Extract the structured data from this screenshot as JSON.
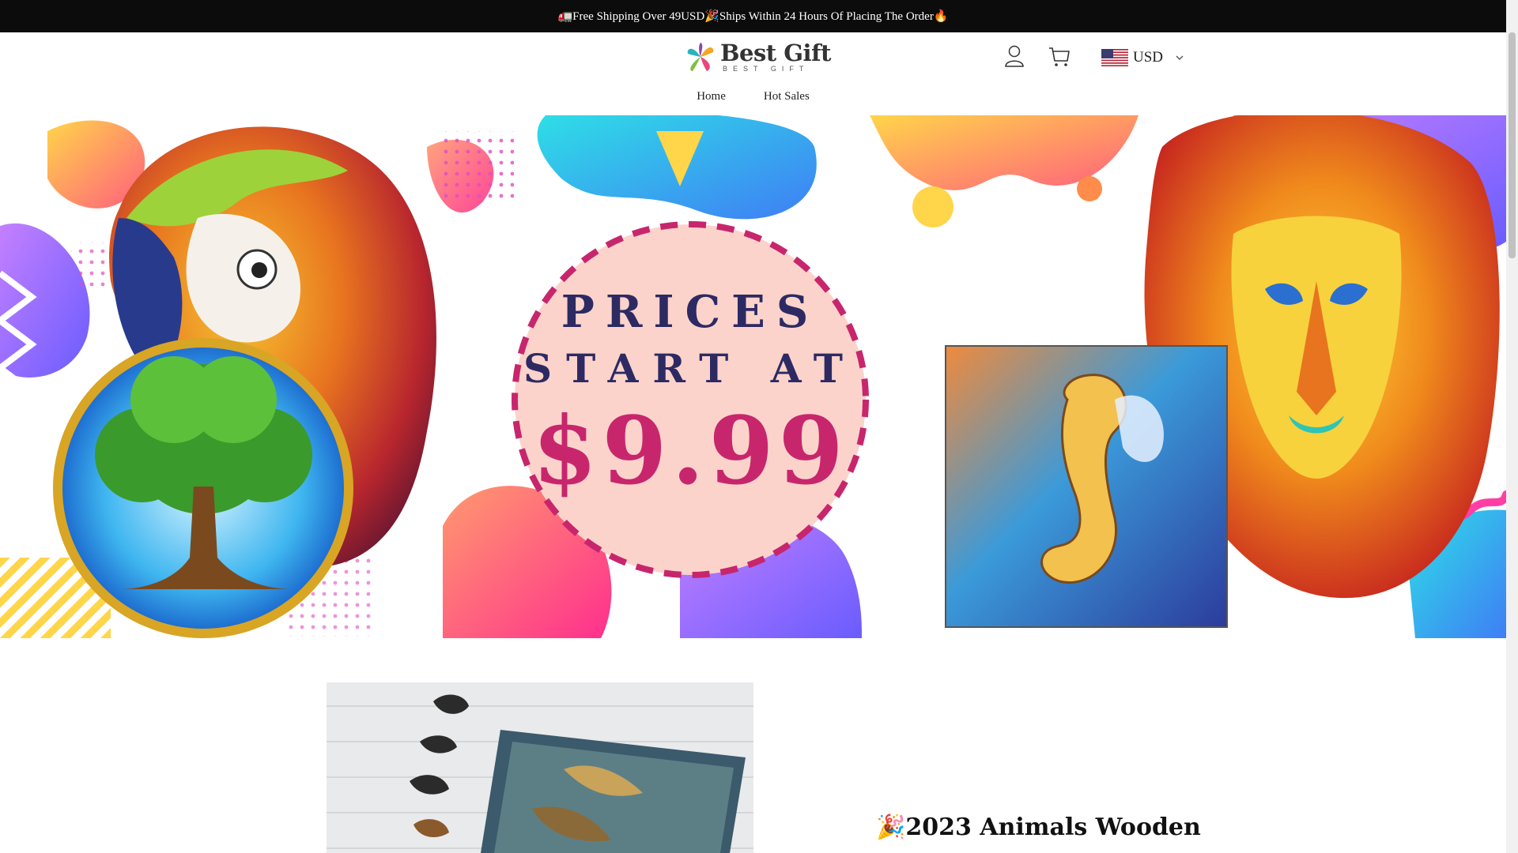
{
  "announcement": {
    "text": "🚛Free Shipping Over 49USD🎉Ships Within 24 Hours Of Placing The Order🔥"
  },
  "header": {
    "logo": {
      "name": "Best Gift",
      "tagline": "BEST GIFT"
    },
    "account_icon": "user-icon",
    "cart_icon": "cart-icon",
    "currency": {
      "flag": "us-flag-icon",
      "code": "USD"
    }
  },
  "nav": {
    "items": [
      {
        "label": "Home"
      },
      {
        "label": "Hot Sales"
      }
    ]
  },
  "hero": {
    "line1": "PRICES",
    "line2": "START AT",
    "price": "$9.99",
    "colors": {
      "circle_fill": "#fcd3cb",
      "dash": "#c7266d",
      "text_navy": "#2d2a63",
      "price_pink": "#c7266d"
    }
  },
  "product": {
    "title": "🎉2023 Animals Wooden"
  },
  "colors": {
    "topbar": "#0c0c0c",
    "page": "#ffffff"
  }
}
